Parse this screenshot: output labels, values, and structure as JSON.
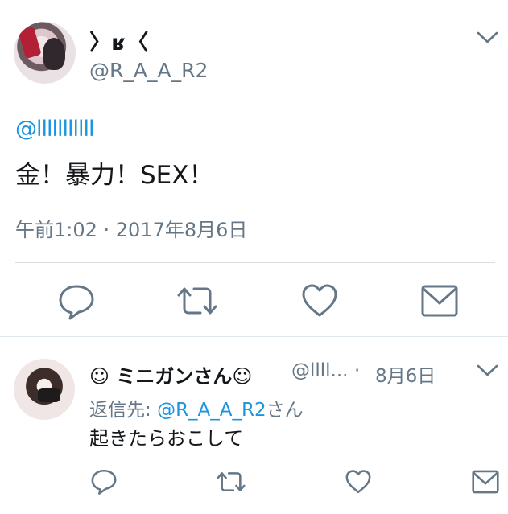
{
  "tweet": {
    "display_name": "〉ʁ〈",
    "handle": "@R_A_A_R2",
    "mention": "@lllllllllll",
    "text": "金！暴力！SEX！",
    "timestamp": "午前1:02 · 2017年8月6日"
  },
  "reply": {
    "display_name": "☺ ミニガンさん☺",
    "handle": "@llll...",
    "separator": "·",
    "date": "8月6日",
    "reply_to_prefix": "返信先: ",
    "reply_to_handle": "@R_A_A_R2",
    "reply_to_suffix": "さん",
    "text": "起きたらおこして"
  },
  "colors": {
    "icon": "#657786",
    "link": "#1b95e0",
    "divider": "#e1e8ed"
  },
  "icons": [
    "chevron-down-icon",
    "reply-icon",
    "retweet-icon",
    "like-icon",
    "dm-icon"
  ]
}
